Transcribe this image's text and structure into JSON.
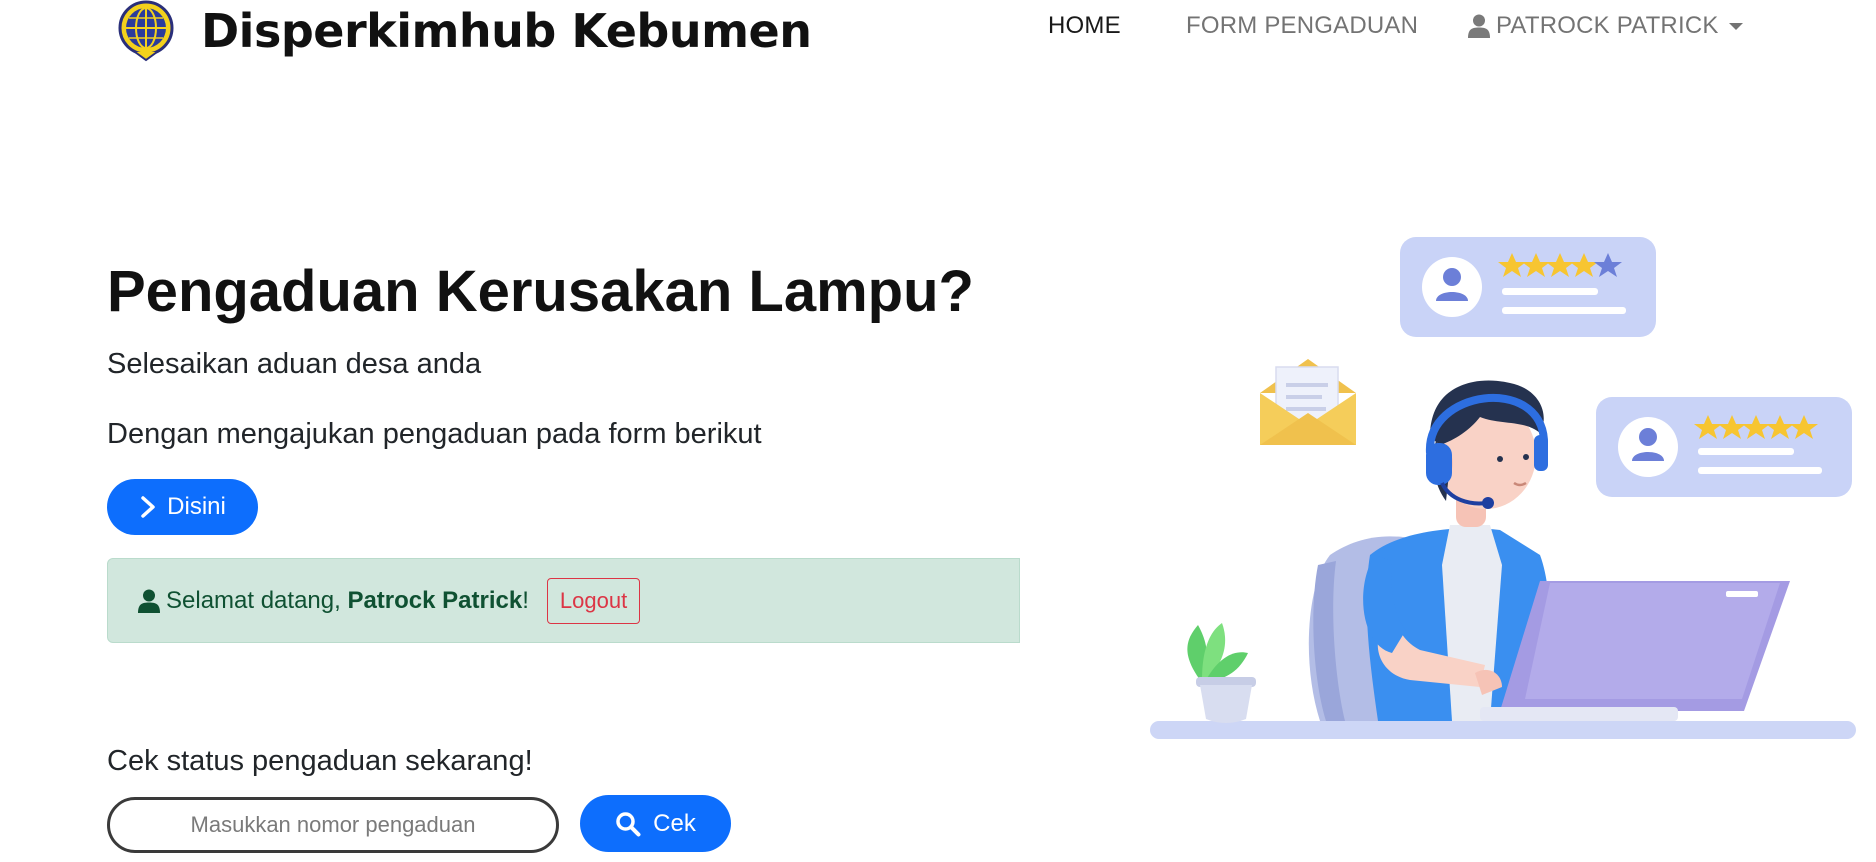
{
  "navbar": {
    "brand": "Disperkimhub Kebumen",
    "items": [
      {
        "label": "HOME"
      },
      {
        "label": "FORM PENGADUAN"
      }
    ],
    "user_menu": {
      "label": "PATROCK PATRICK"
    }
  },
  "hero": {
    "title": "Pengaduan Kerusakan Lampu?",
    "subtitle": "Selesaikan aduan desa anda",
    "description": "Dengan mengajukan pengaduan pada form berikut",
    "cta_label": "Disini"
  },
  "welcome_alert": {
    "prefix": "Selamat datang, ",
    "name": "Patrock Patrick",
    "suffix": "!",
    "logout_label": "Logout"
  },
  "status_check": {
    "label": "Cek status pengaduan sekarang!",
    "input_placeholder": "Masukkan nomor pengaduan",
    "input_value": "",
    "button_label": "Cek"
  },
  "illustration": {
    "top_card_rating": "4 of 5 stars",
    "right_card_rating": "5 of 5 stars"
  },
  "colors": {
    "primary": "#0d6efd",
    "success_bg": "#d1e7dd",
    "success_text": "#0f5132",
    "danger": "#dc3545",
    "card_bg": "#c9d3f7",
    "star": "#f7c531"
  }
}
